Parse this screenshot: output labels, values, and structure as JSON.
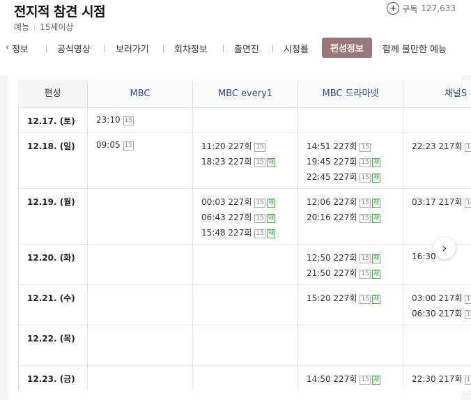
{
  "program": {
    "title": "전지적 참견 시점",
    "genre": "예능",
    "rating": "15세이상"
  },
  "subscribe": {
    "label": "구독",
    "count": "127,633"
  },
  "tabs": {
    "items": [
      "정보",
      "공식영상",
      "보러가기",
      "회차정보",
      "출연진",
      "시청률",
      "편성정보",
      "함께 볼만한 예능"
    ],
    "active_index": 6,
    "accent_color": "#9a7778"
  },
  "table": {
    "headers": [
      "편성",
      "MBC",
      "MBC every1",
      "MBC 드라마넷",
      "채널S"
    ],
    "rows": [
      {
        "date": "12.17. (토)",
        "cells": [
          [
            {
              "time": "23:10",
              "episode": "",
              "rating": "15",
              "rerun": ""
            }
          ],
          [],
          [],
          []
        ]
      },
      {
        "date": "12.18. (일)",
        "cells": [
          [
            {
              "time": "09:05",
              "episode": "",
              "rating": "15",
              "rerun": ""
            }
          ],
          [
            {
              "time": "11:20",
              "episode": "227회",
              "rating": "15",
              "rerun": ""
            },
            {
              "time": "18:23",
              "episode": "227회",
              "rating": "15",
              "rerun": "재"
            }
          ],
          [
            {
              "time": "14:51",
              "episode": "227회",
              "rating": "15",
              "rerun": ""
            },
            {
              "time": "19:45",
              "episode": "227회",
              "rating": "15",
              "rerun": "재"
            },
            {
              "time": "22:45",
              "episode": "227회",
              "rating": "15",
              "rerun": "재"
            }
          ],
          [
            {
              "time": "22:23",
              "episode": "217회",
              "rating": "1",
              "rerun": ""
            }
          ]
        ]
      },
      {
        "date": "12.19. (월)",
        "cells": [
          [],
          [
            {
              "time": "00:03",
              "episode": "227회",
              "rating": "15",
              "rerun": "재"
            },
            {
              "time": "06:43",
              "episode": "227회",
              "rating": "15",
              "rerun": "재"
            },
            {
              "time": "15:48",
              "episode": "227회",
              "rating": "15",
              "rerun": "재"
            }
          ],
          [
            {
              "time": "12:06",
              "episode": "227회",
              "rating": "15",
              "rerun": "재"
            },
            {
              "time": "20:16",
              "episode": "227회",
              "rating": "15",
              "rerun": "재"
            }
          ],
          [
            {
              "time": "03:17",
              "episode": "217회",
              "rating": "1",
              "rerun": ""
            }
          ]
        ]
      },
      {
        "date": "12.20. (화)",
        "cells": [
          [],
          [],
          [
            {
              "time": "12:50",
              "episode": "227회",
              "rating": "15",
              "rerun": "재"
            },
            {
              "time": "21:50",
              "episode": "227회",
              "rating": "15",
              "rerun": "재"
            }
          ],
          [
            {
              "time": "16:30",
              "episode": "",
              "rating": "",
              "rerun": ""
            }
          ]
        ]
      },
      {
        "date": "12.21. (수)",
        "cells": [
          [],
          [],
          [
            {
              "time": "15:20",
              "episode": "227회",
              "rating": "15",
              "rerun": "재"
            }
          ],
          [
            {
              "time": "03:00",
              "episode": "217회",
              "rating": "1",
              "rerun": ""
            },
            {
              "time": "06:30",
              "episode": "217회",
              "rating": "1",
              "rerun": ""
            }
          ]
        ]
      },
      {
        "date": "12.22. (목)",
        "cells": [
          [],
          [],
          [],
          []
        ]
      },
      {
        "date": "12.23. (금)",
        "cells": [
          [],
          [],
          [
            {
              "time": "14:50",
              "episode": "227회",
              "rating": "15",
              "rerun": "재"
            }
          ],
          [
            {
              "time": "22:30",
              "episode": "217회",
              "rating": "1",
              "rerun": ""
            }
          ]
        ]
      }
    ]
  },
  "icons": {
    "plus": "plus-circle-icon",
    "prev": "chevron-left-icon",
    "next": "chevron-right-icon"
  }
}
